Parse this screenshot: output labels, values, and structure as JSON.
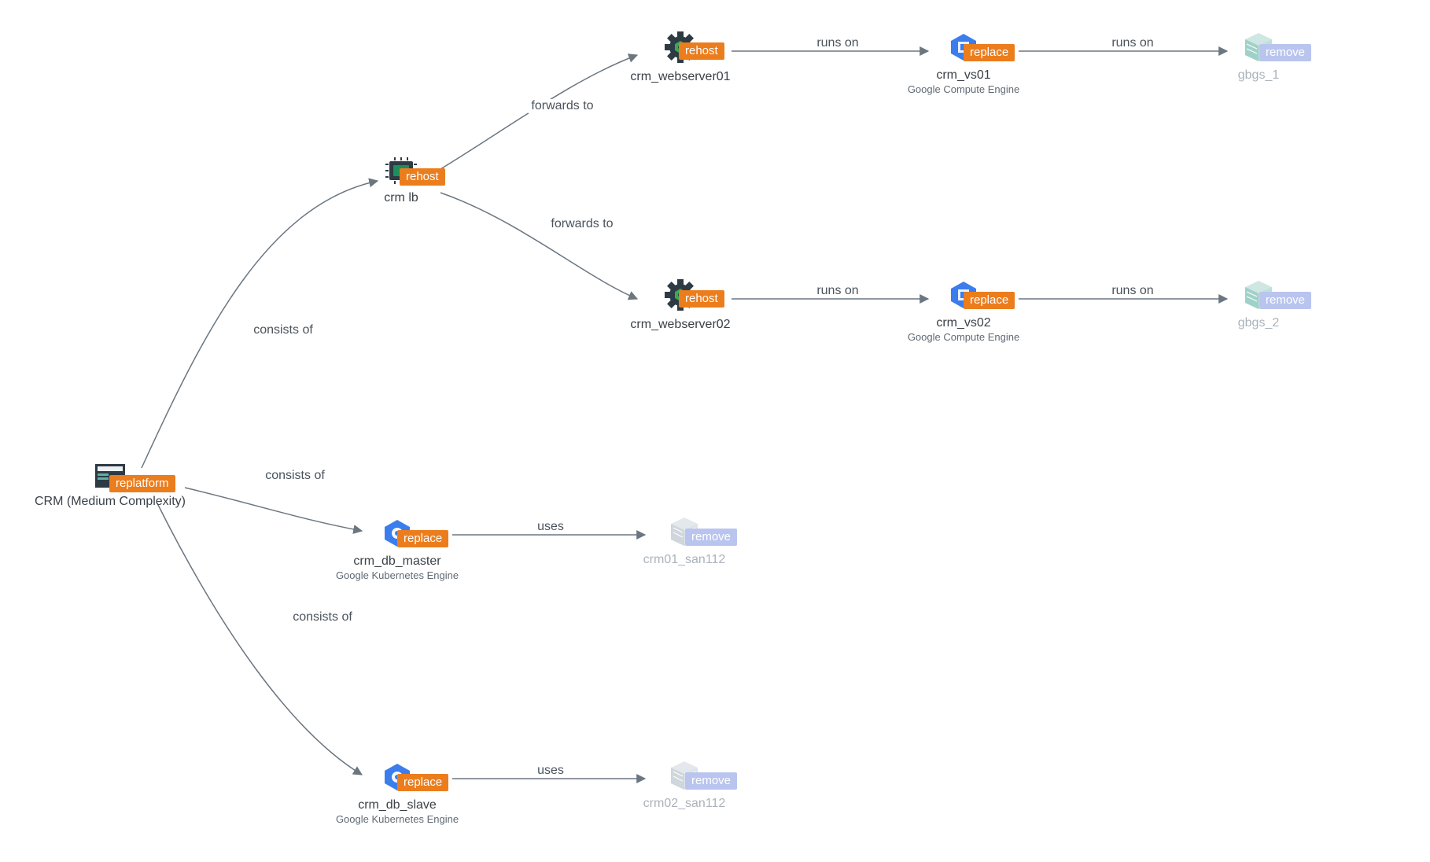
{
  "badges": {
    "replatform": "replatform",
    "rehost": "rehost",
    "replace": "replace",
    "remove": "remove"
  },
  "nodes": {
    "root": {
      "title": "CRM (Medium Complexity)",
      "subtitle": ""
    },
    "lb": {
      "title": "crm lb",
      "subtitle": ""
    },
    "ws1": {
      "title": "crm_webserver01",
      "subtitle": ""
    },
    "ws2": {
      "title": "crm_webserver02",
      "subtitle": ""
    },
    "vs1": {
      "title": "crm_vs01",
      "subtitle": "Google Compute Engine"
    },
    "vs2": {
      "title": "crm_vs02",
      "subtitle": "Google Compute Engine"
    },
    "gbgs1": {
      "title": "gbgs_1",
      "subtitle": ""
    },
    "gbgs2": {
      "title": "gbgs_2",
      "subtitle": ""
    },
    "db_master": {
      "title": "crm_db_master",
      "subtitle": "Google Kubernetes Engine"
    },
    "db_slave": {
      "title": "crm_db_slave",
      "subtitle": "Google Kubernetes Engine"
    },
    "san1": {
      "title": "crm01_san112",
      "subtitle": ""
    },
    "san2": {
      "title": "crm02_san112",
      "subtitle": ""
    }
  },
  "edges": {
    "root_lb": "consists of",
    "root_dbm": "consists of",
    "root_dbs": "consists of",
    "lb_ws1": "forwards to",
    "lb_ws2": "forwards to",
    "ws1_vs1": "runs on",
    "ws2_vs2": "runs on",
    "vs1_gbgs1": "runs on",
    "vs2_gbgs2": "runs on",
    "dbm_san1": "uses",
    "dbs_san2": "uses"
  },
  "colors": {
    "badge_orange": "#eb7d1d",
    "badge_faded": "#b9c5ef",
    "arrow": "#6b7680",
    "hex_blue": "#3b7ded",
    "gear_dark": "#2d3b44",
    "gear_green": "#3aa757",
    "rack_teal": "#6fc3b9",
    "rack_grey": "#cfd6dc",
    "chip_green": "#1d8f5a",
    "app_dark": "#2e3a44"
  }
}
